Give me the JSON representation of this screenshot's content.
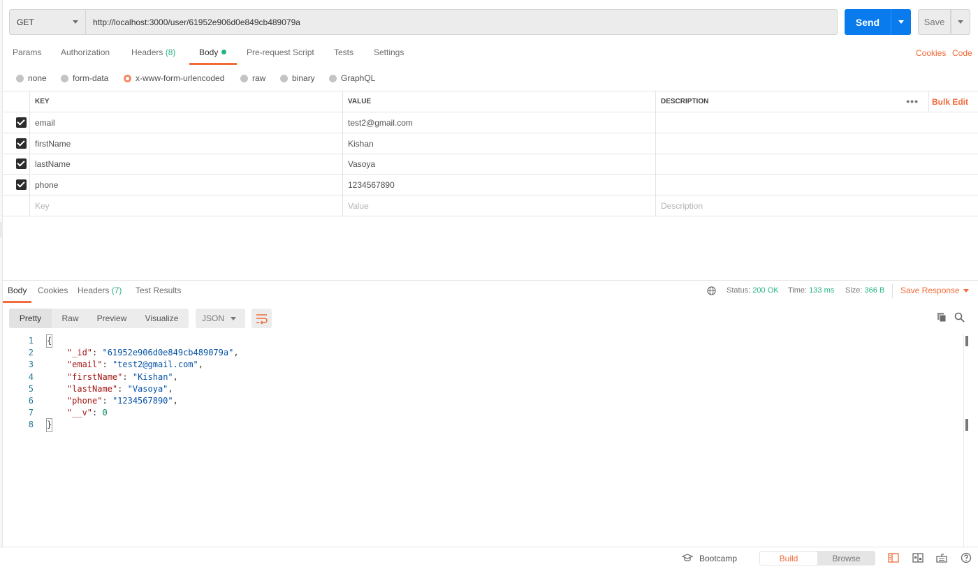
{
  "request": {
    "method": "GET",
    "url": "http://localhost:3000/user/61952e906d0e849cb489079a",
    "send_label": "Send",
    "save_label": "Save"
  },
  "request_tabs": [
    {
      "label": "Params"
    },
    {
      "label": "Authorization"
    },
    {
      "label": "Headers",
      "count": "(8)"
    },
    {
      "label": "Body"
    },
    {
      "label": "Pre-request Script"
    },
    {
      "label": "Tests"
    },
    {
      "label": "Settings"
    }
  ],
  "right_links": {
    "cookies": "Cookies",
    "code": "Code"
  },
  "body_types": [
    {
      "label": "none"
    },
    {
      "label": "form-data"
    },
    {
      "label": "x-www-form-urlencoded",
      "selected": true
    },
    {
      "label": "raw"
    },
    {
      "label": "binary"
    },
    {
      "label": "GraphQL"
    }
  ],
  "params_table": {
    "headers": {
      "key": "KEY",
      "value": "VALUE",
      "description": "DESCRIPTION"
    },
    "bulk_edit": "Bulk Edit",
    "rows": [
      {
        "key": "email",
        "value": "test2@gmail.com",
        "checked": true
      },
      {
        "key": "firstName",
        "value": "Kishan",
        "checked": true
      },
      {
        "key": "lastName",
        "value": "Vasoya",
        "checked": true
      },
      {
        "key": "phone",
        "value": "1234567890",
        "checked": true
      }
    ],
    "placeholders": {
      "key": "Key",
      "value": "Value",
      "description": "Description"
    }
  },
  "response_tabs": [
    {
      "label": "Body"
    },
    {
      "label": "Cookies"
    },
    {
      "label": "Headers",
      "count": "(7)"
    },
    {
      "label": "Test Results"
    }
  ],
  "response_meta": {
    "status_label": "Status:",
    "status": "200 OK",
    "time_label": "Time:",
    "time": "133 ms",
    "size_label": "Size:",
    "size": "366 B",
    "save_response": "Save Response"
  },
  "view_modes": [
    "Pretty",
    "Raw",
    "Preview",
    "Visualize"
  ],
  "format": "JSON",
  "response_body": {
    "line_numbers": [
      "1",
      "2",
      "3",
      "4",
      "5",
      "6",
      "7",
      "8"
    ],
    "open_brace": "{",
    "close_brace": "}",
    "fields": [
      {
        "key": "\"_id\"",
        "value": "\"61952e906d0e849cb489079a\"",
        "type": "string",
        "comma": ","
      },
      {
        "key": "\"email\"",
        "value": "\"test2@gmail.com\"",
        "type": "string",
        "comma": ","
      },
      {
        "key": "\"firstName\"",
        "value": "\"Kishan\"",
        "type": "string",
        "comma": ","
      },
      {
        "key": "\"lastName\"",
        "value": "\"Vasoya\"",
        "type": "string",
        "comma": ","
      },
      {
        "key": "\"phone\"",
        "value": "\"1234567890\"",
        "type": "string",
        "comma": ","
      },
      {
        "key": "\"__v\"",
        "value": "0",
        "type": "number",
        "comma": ""
      }
    ]
  },
  "footer": {
    "bootcamp": "Bootcamp",
    "build": "Build",
    "browse": "Browse"
  },
  "colors": {
    "accent": "#f26b3a",
    "send": "#097bed",
    "success": "#26b47f"
  }
}
